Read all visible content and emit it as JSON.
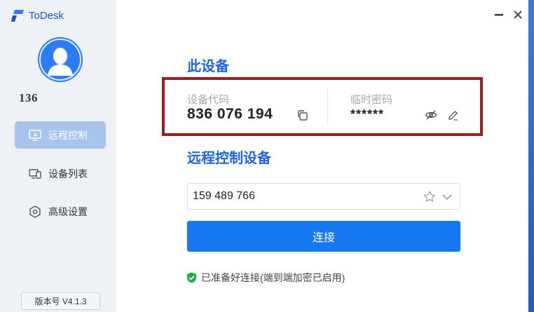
{
  "app": {
    "name": "ToDesk"
  },
  "sidebar": {
    "user_id": "136",
    "items": [
      {
        "label": "远程控制",
        "icon": "remote-control-icon",
        "active": true
      },
      {
        "label": "设备列表",
        "icon": "device-list-icon",
        "active": false
      },
      {
        "label": "高级设置",
        "icon": "settings-icon",
        "active": false
      }
    ],
    "version": "版本号 V4.1.3"
  },
  "this_device": {
    "title": "此设备",
    "code_label": "设备代码",
    "code_value": "836 076 194",
    "password_label": "临时密码",
    "password_value": "******"
  },
  "remote": {
    "title": "远程控制设备",
    "input_value": "159 489 766",
    "connect_label": "连接",
    "status_text": "已准备好连接(端到端加密已启用)"
  },
  "colors": {
    "accent": "#1677f2",
    "title_blue": "#1d64d8",
    "highlight_border": "#a31b1b",
    "status_green": "#1fae4a"
  }
}
